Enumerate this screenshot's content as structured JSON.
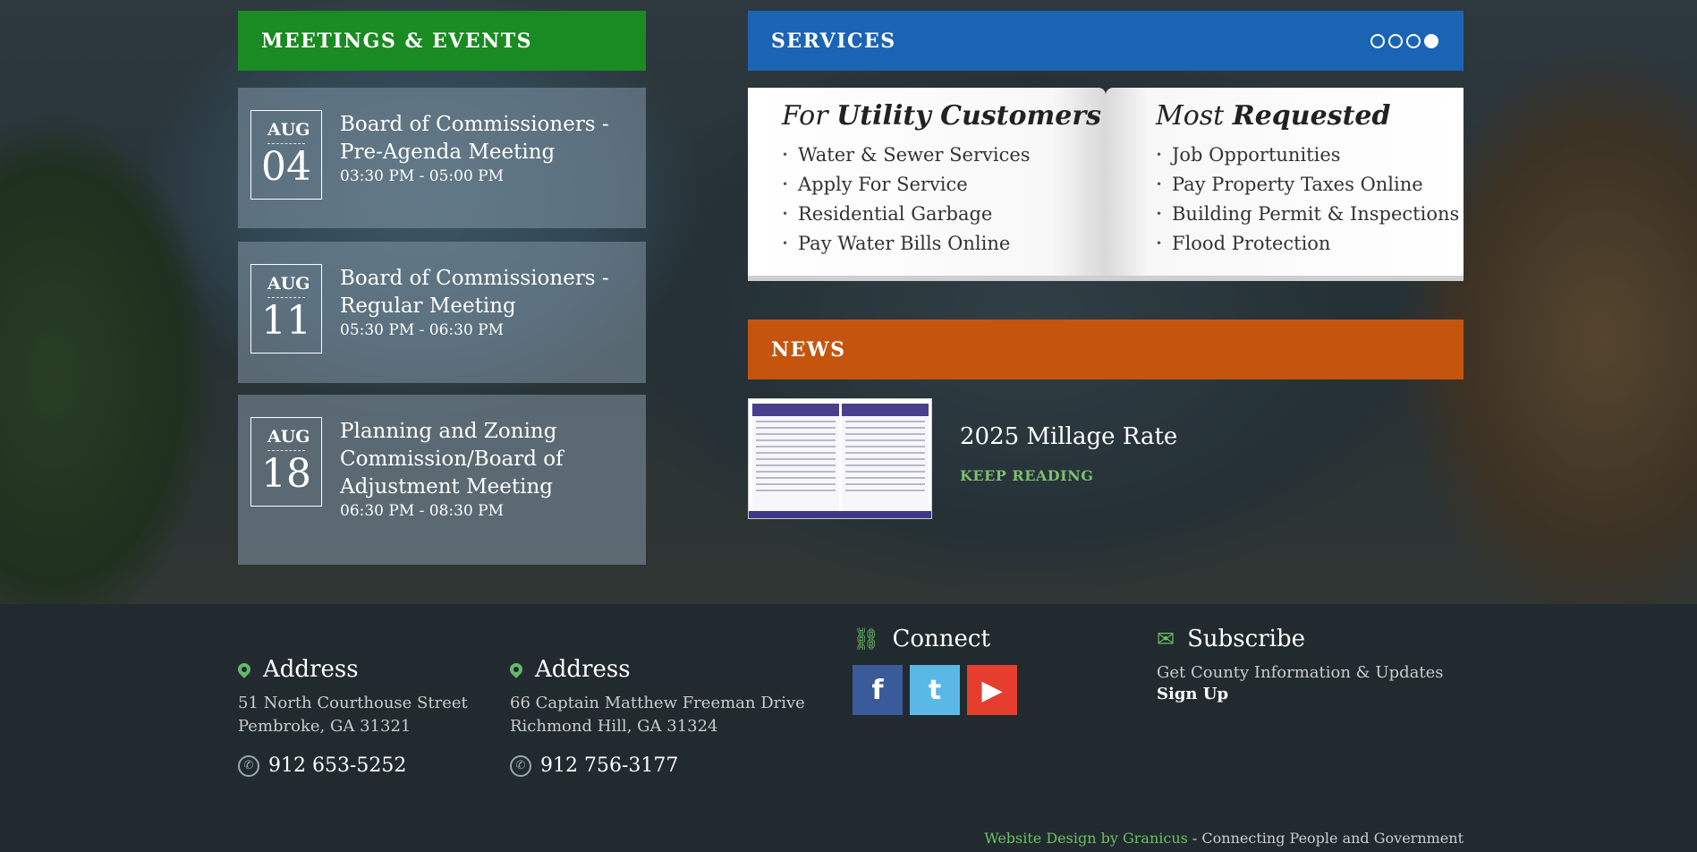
{
  "meetings": {
    "header": "MEETINGS & EVENTS",
    "events": [
      {
        "month": "AUG",
        "day": "04",
        "title": "Board of Commissioners - Pre-Agenda Meeting",
        "time": "03:30 PM - 05:00 PM"
      },
      {
        "month": "AUG",
        "day": "11",
        "title": "Board of Commissioners - Regular Meeting",
        "time": "05:30 PM - 06:30 PM"
      },
      {
        "month": "AUG",
        "day": "18",
        "title": "Planning and Zoning Commission/Board of Adjustment Meeting",
        "time": "06:30 PM - 08:30 PM"
      }
    ]
  },
  "services": {
    "header": "SERVICES",
    "slides_total": 4,
    "active_slide": 4,
    "left": {
      "prefix": "For ",
      "bold": "Utility Customers",
      "items": [
        "Water & Sewer Services",
        "Apply For Service",
        "Residential Garbage",
        "Pay Water Bills Online"
      ]
    },
    "right": {
      "prefix": "Most ",
      "bold": "Requested",
      "items": [
        "Job Opportunities",
        "Pay Property Taxes Online",
        "Building Permit & Inspections",
        "Flood Protection"
      ]
    }
  },
  "news": {
    "header": "NEWS",
    "title": "2025 Millage Rate",
    "link": "KEEP READING"
  },
  "footer": {
    "address1": {
      "label": "Address",
      "line1": "51 North Courthouse Street",
      "line2": "Pembroke, GA 31321",
      "phone": "912 653-5252"
    },
    "address2": {
      "label": "Address",
      "line1": "66 Captain Matthew Freeman Drive",
      "line2": "Richmond Hill, GA 31324",
      "phone": "912 756-3177"
    },
    "connect": {
      "label": "Connect",
      "facebook": "f",
      "twitter": "t",
      "youtube": "▶"
    },
    "subscribe": {
      "label": "Subscribe",
      "text": "Get County Information & Updates",
      "link": "Sign Up"
    },
    "credit": {
      "link": "Website Design by Granicus",
      "rest": " - Connecting People and Government"
    }
  },
  "colors": {
    "meetings": "#1a8a22",
    "services": "#1b64b4",
    "news": "#c5550e",
    "accent_green": "#6cbf62"
  }
}
